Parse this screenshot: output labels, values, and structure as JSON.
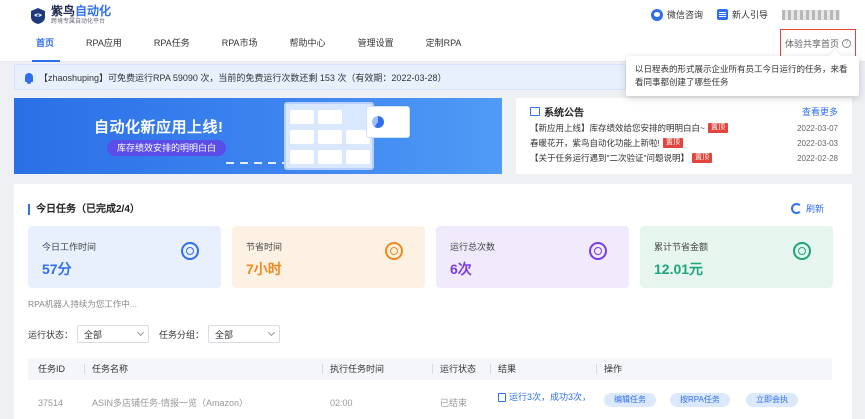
{
  "app": {
    "logo_title_main": "紫鸟",
    "logo_title_accent": "自动化",
    "logo_sub": "跨境专属自动化平台"
  },
  "top_links": {
    "wechat": "微信咨询",
    "guide": "新人引导",
    "user": "yuzhi"
  },
  "nav": {
    "items": [
      "首页",
      "RPA应用",
      "RPA任务",
      "RPA市场",
      "帮助中心",
      "管理设置",
      "定制RPA"
    ],
    "active": "首页"
  },
  "share": {
    "label": "体验共享首页",
    "help": "?"
  },
  "tooltip": {
    "text": "以日程表的形式展示企业所有员工今日运行的任务，来看看同事都创建了哪些任务"
  },
  "notice": {
    "text": "【zhaoshuping】可免费运行RPA 59090 次，当前的免费运行次数还剩 153 次（有效期：2022-03-28）"
  },
  "banner": {
    "title": "自动化新应用上线!",
    "subtitle": "库存绩效安排的明明白白"
  },
  "announcements": {
    "title": "系统公告",
    "see_more": "查看更多",
    "items": [
      {
        "text": "【新应用上线】库存绩效给您安排的明明白白~",
        "tag": "置顶",
        "date": "2022-03-07"
      },
      {
        "text": "春暖花开，紫鸟自动化功能上新啦!",
        "tag": "置顶",
        "date": "2022-03-03"
      },
      {
        "text": "【关于任务运行遇到\"二次验证\"问题说明】",
        "tag": "置顶",
        "date": "2022-02-28"
      }
    ]
  },
  "tasks": {
    "title": "今日任务（已完成2/4）",
    "refresh": "刷新",
    "stats": [
      {
        "label": "今日工作时间",
        "value": "57分",
        "color": "#2f6fed",
        "bg": "#e8f0fe",
        "icon": "clock-icon"
      },
      {
        "label": "节省时间",
        "value": "7小时",
        "color": "#f08a1c",
        "bg": "#fdf1e3",
        "icon": "hourglass-icon"
      },
      {
        "label": "运行总次数",
        "value": "6次",
        "color": "#7a3ce6",
        "bg": "#f1eafd",
        "icon": "run-icon"
      },
      {
        "label": "累计节省金额",
        "value": "12.01元",
        "color": "#1ba57a",
        "bg": "#e6f6ef",
        "icon": "coin-icon"
      }
    ],
    "robot_status": "RPA机器人持续为您工作中...",
    "filters": {
      "status_label": "运行状态：",
      "status_value": "全部",
      "group_label": "任务分组：",
      "group_value": "全部"
    },
    "columns": [
      "任务ID",
      "任务名称",
      "执行任务时间",
      "运行状态",
      "结果",
      "操作"
    ],
    "row": {
      "id": "37514",
      "name": "ASIN多店铺任务-情报一览（Amazon）",
      "time": "02:00",
      "status": "已结束",
      "result": "运行3次，成功3次，",
      "ops": [
        "编辑任务",
        "按RPA任务",
        "立即会执"
      ]
    }
  }
}
